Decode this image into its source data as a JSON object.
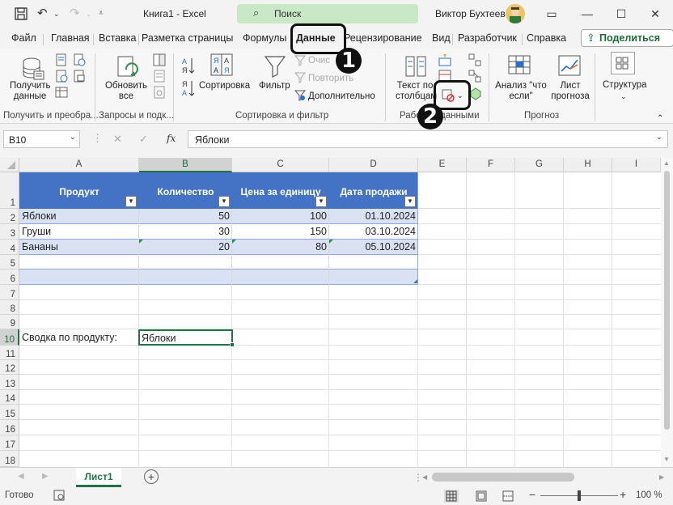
{
  "titlebar": {
    "doc_title": "Книга1 - Excel",
    "search_placeholder": "Поиск",
    "user_name": "Виктор Бухтеев"
  },
  "tabs": [
    "Файл",
    "Главная",
    "Вставка",
    "Разметка страницы",
    "Формулы",
    "Данные",
    "Рецензирование",
    "Вид",
    "Разработчик",
    "Справка"
  ],
  "share_label": "Поделиться",
  "ribbon": {
    "get_data": "Получить данные",
    "refresh_all": "Обновить все",
    "sort": "Сортировка",
    "filter": "Фильтр",
    "clear": "Очис",
    "reapply": "Повторить",
    "advanced": "Дополнительно",
    "text_to_columns": "Текст по столбцам",
    "what_if": "Анализ \"что если\"",
    "forecast_sheet": "Лист прогноза",
    "outline": "Структура",
    "groups": {
      "get_transform": "Получить и преобра...",
      "queries": "Запросы и подк...",
      "sort_filter": "Сортировка и фильтр",
      "data_tools": "Работа с данными",
      "forecast": "Прогноз"
    }
  },
  "formula_bar": {
    "name_box": "B10",
    "formula": "Яблоки"
  },
  "columns": [
    "A",
    "B",
    "C",
    "D",
    "E",
    "F",
    "G",
    "H",
    "I"
  ],
  "rows": [
    "1",
    "2",
    "3",
    "4",
    "5",
    "6",
    "7",
    "8",
    "9",
    "10",
    "11",
    "12",
    "13",
    "14",
    "15",
    "16",
    "17",
    "18"
  ],
  "table": {
    "headers": [
      "Продукт",
      "Количество",
      "Цена за единицу",
      "Дата продажи"
    ],
    "data": [
      [
        "Яблоки",
        "50",
        "100",
        "01.10.2024"
      ],
      [
        "Груши",
        "30",
        "150",
        "03.10.2024"
      ],
      [
        "Бананы",
        "20",
        "80",
        "05.10.2024"
      ]
    ]
  },
  "summary": {
    "label": "Сводка по продукту:",
    "value": "Яблоки"
  },
  "sheet_tab": "Лист1",
  "status": {
    "ready": "Готово",
    "zoom": "100 %"
  },
  "annotations": [
    "1",
    "2"
  ],
  "colors": {
    "accent": "#217346",
    "table_header": "#4472c4",
    "band": "#d9e1f2",
    "search_bg": "#c9e8c6"
  }
}
